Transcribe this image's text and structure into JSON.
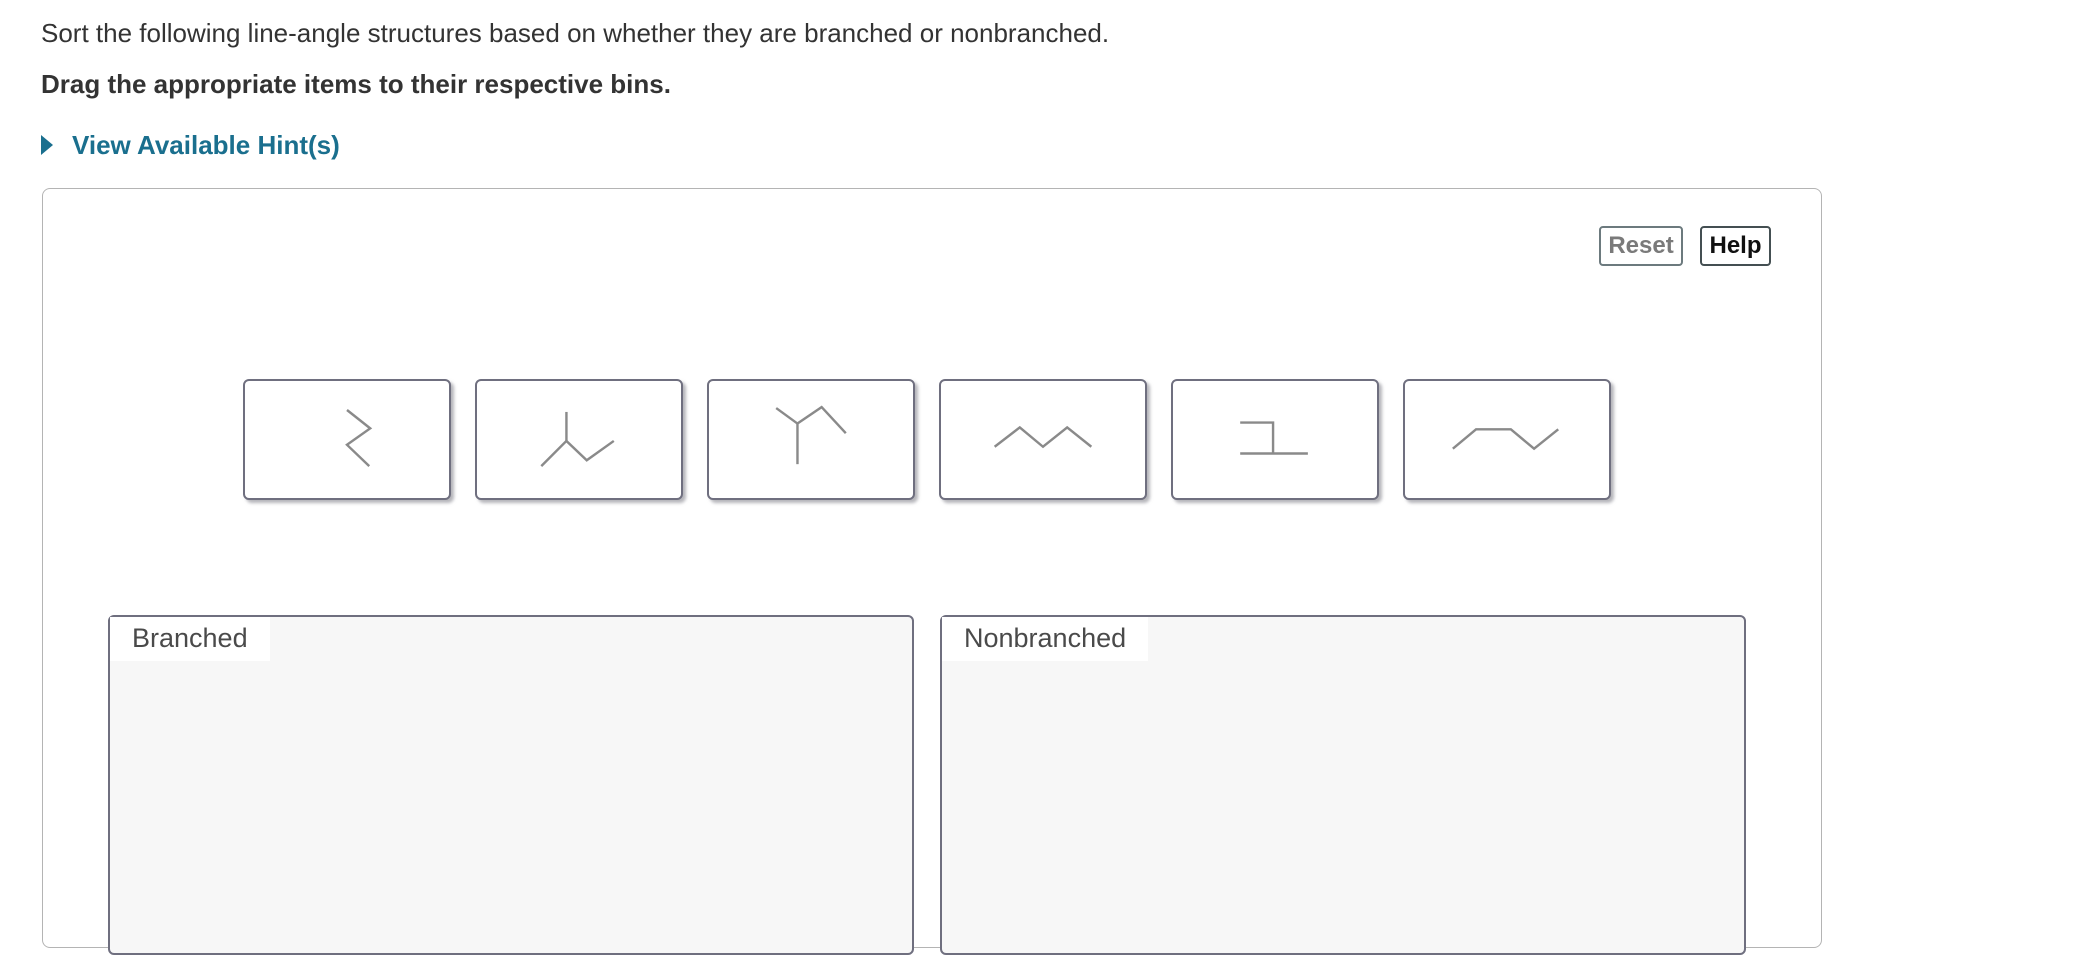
{
  "question": {
    "instructions": "Sort the following line-angle structures based on whether they are branched or nonbranched.",
    "directive": "Drag the appropriate items to their respective bins."
  },
  "hint": {
    "label": "View Available Hint(s)",
    "color": "#1a6f8e"
  },
  "toolbar": {
    "reset_label": "Reset",
    "help_label": "Help"
  },
  "items": [
    {
      "name": "zigzag-vertical-structure"
    },
    {
      "name": "branched-down-structure"
    },
    {
      "name": "y-branched-structure"
    },
    {
      "name": "zigzag-horizontal-structure"
    },
    {
      "name": "bracket-structure"
    },
    {
      "name": "bent-chain-structure"
    }
  ],
  "bins": [
    {
      "label": "Branched"
    },
    {
      "label": "Nonbranched"
    }
  ]
}
